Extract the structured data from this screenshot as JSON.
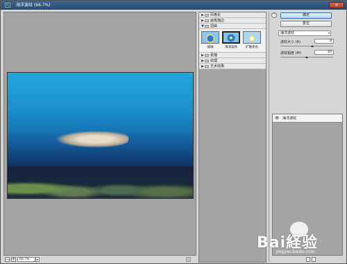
{
  "window": {
    "title": "海洋波纹 (66.7%)",
    "close_glyph": "✕"
  },
  "zoom": {
    "value": "66.7%",
    "minus": "−",
    "plus": "+",
    "arrow": "▾"
  },
  "gallery": {
    "categories": [
      {
        "label": "风格化",
        "expanded": false
      },
      {
        "label": "画笔描边",
        "expanded": false
      },
      {
        "label": "扭曲",
        "expanded": true
      },
      {
        "label": "素描",
        "expanded": false
      },
      {
        "label": "纹理",
        "expanded": false
      },
      {
        "label": "艺术效果",
        "expanded": false
      }
    ],
    "thumbnails": [
      {
        "label": "玻璃",
        "selected": false
      },
      {
        "label": "海洋波纹",
        "selected": true
      },
      {
        "label": "扩散亮光",
        "selected": false
      }
    ]
  },
  "settings": {
    "ok_label": "确定",
    "reset_label": "复位",
    "filter_select": "海洋波纹",
    "params": [
      {
        "label": "波纹大小 (R)",
        "value": "9",
        "fraction": 0.6
      },
      {
        "label": "波纹幅度 (M)",
        "value": "10",
        "fraction": 0.5
      }
    ]
  },
  "layers": {
    "items": [
      {
        "name": "海洋波纹",
        "visible": true
      }
    ]
  },
  "watermark": {
    "brand": "Bai経验",
    "sub": "jingyan.baidu.com"
  },
  "colors": {
    "accent": "#3a6fa5",
    "panel": "#a4a4a4",
    "chrome": "#d6d6d6"
  }
}
